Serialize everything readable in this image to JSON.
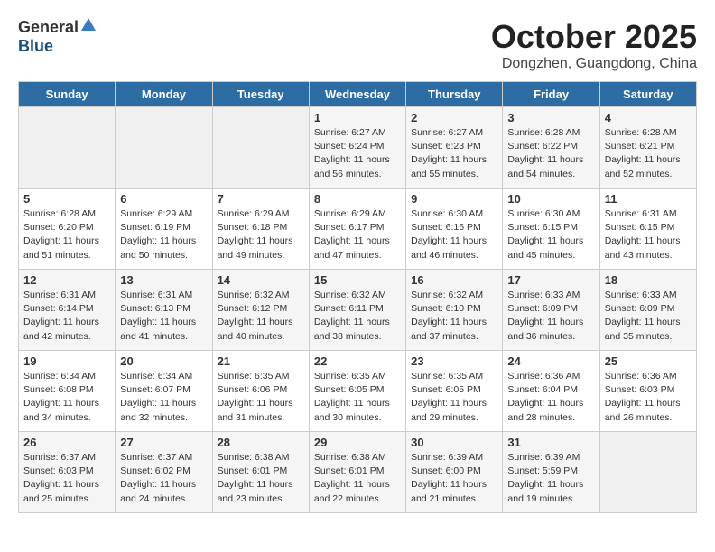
{
  "header": {
    "logo_general": "General",
    "logo_blue": "Blue",
    "title": "October 2025",
    "subtitle": "Dongzhen, Guangdong, China"
  },
  "days_of_week": [
    "Sunday",
    "Monday",
    "Tuesday",
    "Wednesday",
    "Thursday",
    "Friday",
    "Saturday"
  ],
  "weeks": [
    [
      {
        "day": "",
        "info": ""
      },
      {
        "day": "",
        "info": ""
      },
      {
        "day": "",
        "info": ""
      },
      {
        "day": "1",
        "info": "Sunrise: 6:27 AM\nSunset: 6:24 PM\nDaylight: 11 hours and 56 minutes."
      },
      {
        "day": "2",
        "info": "Sunrise: 6:27 AM\nSunset: 6:23 PM\nDaylight: 11 hours and 55 minutes."
      },
      {
        "day": "3",
        "info": "Sunrise: 6:28 AM\nSunset: 6:22 PM\nDaylight: 11 hours and 54 minutes."
      },
      {
        "day": "4",
        "info": "Sunrise: 6:28 AM\nSunset: 6:21 PM\nDaylight: 11 hours and 52 minutes."
      }
    ],
    [
      {
        "day": "5",
        "info": "Sunrise: 6:28 AM\nSunset: 6:20 PM\nDaylight: 11 hours and 51 minutes."
      },
      {
        "day": "6",
        "info": "Sunrise: 6:29 AM\nSunset: 6:19 PM\nDaylight: 11 hours and 50 minutes."
      },
      {
        "day": "7",
        "info": "Sunrise: 6:29 AM\nSunset: 6:18 PM\nDaylight: 11 hours and 49 minutes."
      },
      {
        "day": "8",
        "info": "Sunrise: 6:29 AM\nSunset: 6:17 PM\nDaylight: 11 hours and 47 minutes."
      },
      {
        "day": "9",
        "info": "Sunrise: 6:30 AM\nSunset: 6:16 PM\nDaylight: 11 hours and 46 minutes."
      },
      {
        "day": "10",
        "info": "Sunrise: 6:30 AM\nSunset: 6:15 PM\nDaylight: 11 hours and 45 minutes."
      },
      {
        "day": "11",
        "info": "Sunrise: 6:31 AM\nSunset: 6:15 PM\nDaylight: 11 hours and 43 minutes."
      }
    ],
    [
      {
        "day": "12",
        "info": "Sunrise: 6:31 AM\nSunset: 6:14 PM\nDaylight: 11 hours and 42 minutes."
      },
      {
        "day": "13",
        "info": "Sunrise: 6:31 AM\nSunset: 6:13 PM\nDaylight: 11 hours and 41 minutes."
      },
      {
        "day": "14",
        "info": "Sunrise: 6:32 AM\nSunset: 6:12 PM\nDaylight: 11 hours and 40 minutes."
      },
      {
        "day": "15",
        "info": "Sunrise: 6:32 AM\nSunset: 6:11 PM\nDaylight: 11 hours and 38 minutes."
      },
      {
        "day": "16",
        "info": "Sunrise: 6:32 AM\nSunset: 6:10 PM\nDaylight: 11 hours and 37 minutes."
      },
      {
        "day": "17",
        "info": "Sunrise: 6:33 AM\nSunset: 6:09 PM\nDaylight: 11 hours and 36 minutes."
      },
      {
        "day": "18",
        "info": "Sunrise: 6:33 AM\nSunset: 6:09 PM\nDaylight: 11 hours and 35 minutes."
      }
    ],
    [
      {
        "day": "19",
        "info": "Sunrise: 6:34 AM\nSunset: 6:08 PM\nDaylight: 11 hours and 34 minutes."
      },
      {
        "day": "20",
        "info": "Sunrise: 6:34 AM\nSunset: 6:07 PM\nDaylight: 11 hours and 32 minutes."
      },
      {
        "day": "21",
        "info": "Sunrise: 6:35 AM\nSunset: 6:06 PM\nDaylight: 11 hours and 31 minutes."
      },
      {
        "day": "22",
        "info": "Sunrise: 6:35 AM\nSunset: 6:05 PM\nDaylight: 11 hours and 30 minutes."
      },
      {
        "day": "23",
        "info": "Sunrise: 6:35 AM\nSunset: 6:05 PM\nDaylight: 11 hours and 29 minutes."
      },
      {
        "day": "24",
        "info": "Sunrise: 6:36 AM\nSunset: 6:04 PM\nDaylight: 11 hours and 28 minutes."
      },
      {
        "day": "25",
        "info": "Sunrise: 6:36 AM\nSunset: 6:03 PM\nDaylight: 11 hours and 26 minutes."
      }
    ],
    [
      {
        "day": "26",
        "info": "Sunrise: 6:37 AM\nSunset: 6:03 PM\nDaylight: 11 hours and 25 minutes."
      },
      {
        "day": "27",
        "info": "Sunrise: 6:37 AM\nSunset: 6:02 PM\nDaylight: 11 hours and 24 minutes."
      },
      {
        "day": "28",
        "info": "Sunrise: 6:38 AM\nSunset: 6:01 PM\nDaylight: 11 hours and 23 minutes."
      },
      {
        "day": "29",
        "info": "Sunrise: 6:38 AM\nSunset: 6:01 PM\nDaylight: 11 hours and 22 minutes."
      },
      {
        "day": "30",
        "info": "Sunrise: 6:39 AM\nSunset: 6:00 PM\nDaylight: 11 hours and 21 minutes."
      },
      {
        "day": "31",
        "info": "Sunrise: 6:39 AM\nSunset: 5:59 PM\nDaylight: 11 hours and 19 minutes."
      },
      {
        "day": "",
        "info": ""
      }
    ]
  ]
}
